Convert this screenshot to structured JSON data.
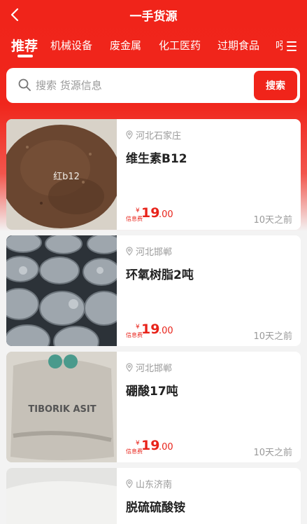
{
  "header": {
    "title": "一手货源"
  },
  "tabs": [
    {
      "label": "推荐",
      "active": true
    },
    {
      "label": "机械设备"
    },
    {
      "label": "废金属"
    },
    {
      "label": "化工医药"
    },
    {
      "label": "过期食品"
    },
    {
      "label": "吲"
    }
  ],
  "search": {
    "placeholder": "搜索 货源信息",
    "button_label": "搜索"
  },
  "listings": [
    {
      "location": "河北石家庄",
      "name": "维生素B12",
      "fee_label": "信息费",
      "currency": "¥",
      "price_int": "19",
      "price_dec": ".00",
      "time": "10天之前",
      "image_caption": "红b12"
    },
    {
      "location": "河北邯郸",
      "name": "环氧树脂2吨",
      "fee_label": "信息费",
      "currency": "¥",
      "price_int": "19",
      "price_dec": ".00",
      "time": "10天之前"
    },
    {
      "location": "河北邯郸",
      "name": "硼酸17吨",
      "fee_label": "信息费",
      "currency": "¥",
      "price_int": "19",
      "price_dec": ".00",
      "time": "10天之前",
      "image_caption": "TIBORIK ASIT"
    },
    {
      "location": "山东济南",
      "name": "脱硫硫酸铵"
    }
  ],
  "colors": {
    "brand": "#f0241a",
    "price": "#e8231a"
  }
}
